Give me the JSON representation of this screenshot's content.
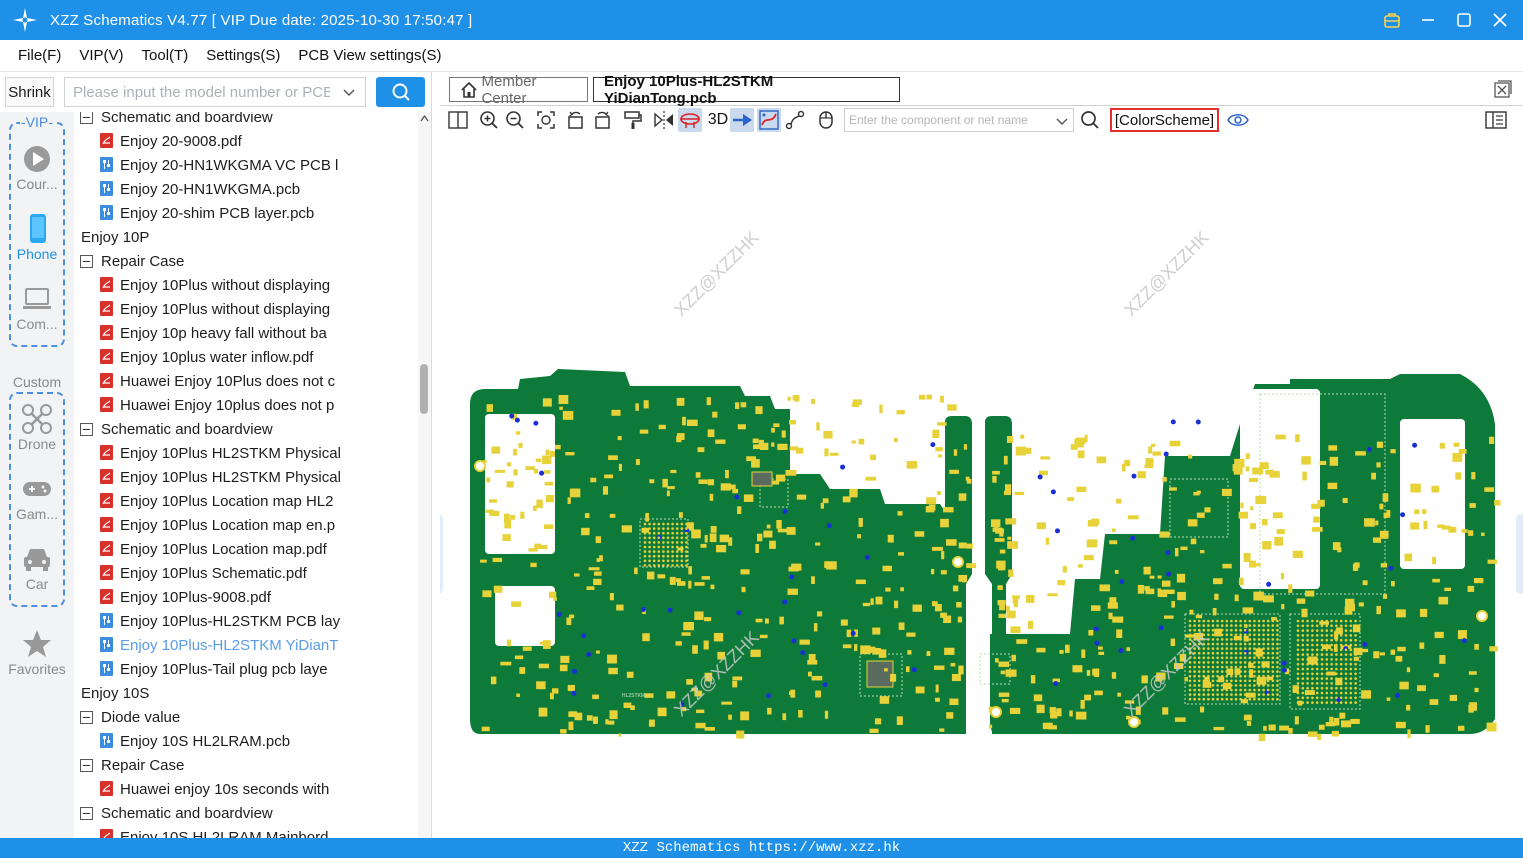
{
  "window": {
    "title": "XZZ Schematics V4.77 [ VIP Due date: 2025-10-30 17:50:47 ]",
    "logo_icon": "xzz-star-logo",
    "accent_color": "#1e90e8"
  },
  "menu": [
    "File(F)",
    "VIP(V)",
    "Tool(T)",
    "Settings(S)",
    "PCB View settings(S)"
  ],
  "left": {
    "shrink_label": "Shrink",
    "search_placeholder": "Please input the model number or PCB"
  },
  "rail": {
    "vip_label": "-VIP-",
    "custom_label": "Custom",
    "items": [
      {
        "label": "Cour...",
        "icon": "play-icon"
      },
      {
        "label": "Phone",
        "icon": "phone-icon",
        "active": true
      },
      {
        "label": "Com...",
        "icon": "laptop-icon"
      },
      {
        "label": "Drone",
        "icon": "drone-icon"
      },
      {
        "label": "Gam...",
        "icon": "gamepad-icon"
      },
      {
        "label": "Car",
        "icon": "car-icon"
      },
      {
        "label": "Favorites",
        "icon": "star-icon"
      }
    ]
  },
  "tree": [
    {
      "text": "Schematic and boardview",
      "level": 2,
      "kind": "folder"
    },
    {
      "text": "Enjoy 20-9008.pdf",
      "level": 3,
      "kind": "pdf"
    },
    {
      "text": "Enjoy 20-HN1WKGMA VC PCB l",
      "level": 3,
      "kind": "pcb"
    },
    {
      "text": "Enjoy 20-HN1WKGMA.pcb",
      "level": 3,
      "kind": "pcb"
    },
    {
      "text": "Enjoy 20-shim PCB layer.pcb",
      "level": 3,
      "kind": "pcb"
    },
    {
      "text": "Enjoy 10P",
      "level": 1,
      "kind": "folder"
    },
    {
      "text": "Repair Case",
      "level": 2,
      "kind": "folder"
    },
    {
      "text": "Enjoy 10Plus without displaying",
      "level": 3,
      "kind": "pdf"
    },
    {
      "text": "Enjoy 10Plus without displaying",
      "level": 3,
      "kind": "pdf"
    },
    {
      "text": "Enjoy 10p heavy fall without ba",
      "level": 3,
      "kind": "pdf"
    },
    {
      "text": "Enjoy 10plus water inflow.pdf",
      "level": 3,
      "kind": "pdf"
    },
    {
      "text": "Huawei Enjoy 10Plus does not c",
      "level": 3,
      "kind": "pdf"
    },
    {
      "text": "Huawei Enjoy 10plus does not p",
      "level": 3,
      "kind": "pdf"
    },
    {
      "text": "Schematic and boardview",
      "level": 2,
      "kind": "folder"
    },
    {
      "text": "Enjoy 10Plus HL2STKM Physical",
      "level": 3,
      "kind": "pdf"
    },
    {
      "text": "Enjoy 10Plus HL2STKM Physical",
      "level": 3,
      "kind": "pdf"
    },
    {
      "text": "Enjoy 10Plus Location map HL2",
      "level": 3,
      "kind": "pdf"
    },
    {
      "text": "Enjoy 10Plus Location map en.p",
      "level": 3,
      "kind": "pdf"
    },
    {
      "text": "Enjoy 10Plus Location map.pdf",
      "level": 3,
      "kind": "pdf"
    },
    {
      "text": "Enjoy 10Plus Schematic.pdf",
      "level": 3,
      "kind": "pdf"
    },
    {
      "text": "Enjoy 10Plus-9008.pdf",
      "level": 3,
      "kind": "pdf"
    },
    {
      "text": "Enjoy 10Plus-HL2STKM PCB lay",
      "level": 3,
      "kind": "pcb"
    },
    {
      "text": "Enjoy 10Plus-HL2STKM YiDianT",
      "level": 3,
      "kind": "pcb",
      "selected": true
    },
    {
      "text": "Enjoy 10Plus-Tail plug pcb laye",
      "level": 3,
      "kind": "pcb"
    },
    {
      "text": "Enjoy 10S",
      "level": 1,
      "kind": "folder"
    },
    {
      "text": "Diode value",
      "level": 2,
      "kind": "folder"
    },
    {
      "text": "Enjoy 10S HL2LRAM.pcb",
      "level": 3,
      "kind": "pcb"
    },
    {
      "text": "Repair Case",
      "level": 2,
      "kind": "folder"
    },
    {
      "text": "Huawei enjoy 10s seconds with",
      "level": 3,
      "kind": "pdf"
    },
    {
      "text": "Schematic and boardview",
      "level": 2,
      "kind": "folder"
    },
    {
      "text": "Enjoy 10S HL2LRAM Mainbord",
      "level": 3,
      "kind": "pdf"
    }
  ],
  "tabs": {
    "member_center": "Member Center",
    "active_file": "Enjoy 10Plus-HL2STKM YiDianTong.pcb"
  },
  "toolbar": {
    "three_d_label": "3D",
    "component_placeholder": "Enter the component or net name",
    "color_scheme_label": "[ColorScheme]"
  },
  "canvas": {
    "watermark": "XZZ@XZZHK",
    "board_color": "#0e7a3a",
    "pad_color": "#e8d23a",
    "via_color": "#1a2fd6",
    "chip_label": "HL2STKM"
  },
  "status": "XZZ Schematics https://www.xzz.hk"
}
